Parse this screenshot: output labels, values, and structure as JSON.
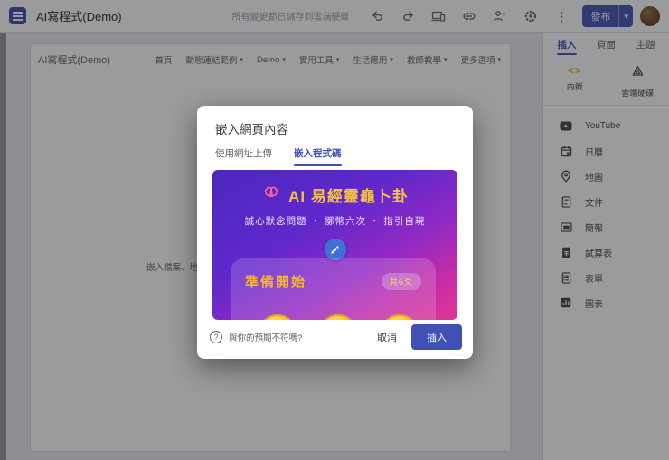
{
  "topbar": {
    "app_title": "AI寫程式(Demo)",
    "save_status": "所有變更都已儲存到雲端硬碟",
    "publish_label": "發布"
  },
  "canvas": {
    "site_title": "AI寫程式(Demo)",
    "nav": [
      {
        "label": "首頁",
        "has_menu": false
      },
      {
        "label": "動態連結範例",
        "has_menu": true
      },
      {
        "label": "Demo",
        "has_menu": true
      },
      {
        "label": "實用工具",
        "has_menu": true
      },
      {
        "label": "生活應用",
        "has_menu": true
      },
      {
        "label": "教師教學",
        "has_menu": true
      },
      {
        "label": "更多選項",
        "has_menu": true
      }
    ],
    "placeholder_text": "嵌入檔案、地"
  },
  "sidebar": {
    "tabs": [
      {
        "label": "插入",
        "active": true
      },
      {
        "label": "頁面",
        "active": false
      },
      {
        "label": "主題",
        "active": false
      }
    ],
    "tiles": [
      {
        "label": "內嵌"
      },
      {
        "label": "雲端硬碟"
      }
    ],
    "items": [
      {
        "label": "YouTube"
      },
      {
        "label": "日曆"
      },
      {
        "label": "地圖"
      },
      {
        "label": "文件"
      },
      {
        "label": "簡報"
      },
      {
        "label": "試算表"
      },
      {
        "label": "表單"
      },
      {
        "label": "圖表"
      }
    ]
  },
  "modal": {
    "title": "嵌入網頁內容",
    "tabs": [
      {
        "label": "使用網址上傳",
        "active": false
      },
      {
        "label": "嵌入程式碼",
        "active": true
      }
    ],
    "preview": {
      "title": "AI 易經靈龜卜卦",
      "subtitle": "誠心默念問題 ・ 擲幣六次 ・ 指引自現",
      "card_title": "準備開始",
      "badge": "共6爻"
    },
    "footer": {
      "hint": "與你的預期不符嗎?",
      "cancel_label": "取消",
      "insert_label": "插入"
    }
  },
  "icons": {
    "chevron_down": "▾",
    "kebab": "⋮",
    "embed_code": "<>",
    "help": "?"
  },
  "colors": {
    "accent_indigo": "#3f51b5",
    "embed_icon_gold": "#f9ab00",
    "preview_title_gold": "#f6c244",
    "preview_gradient_start": "#4b27bd",
    "preview_gradient_end": "#e03694"
  }
}
